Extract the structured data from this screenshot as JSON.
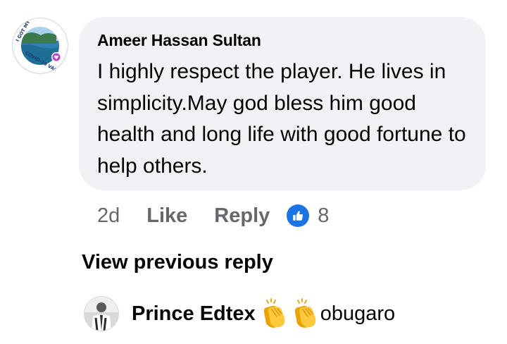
{
  "comment": {
    "author": "Ameer Hassan Sultan",
    "text": "I highly respect the player. He lives in simplicity.May god bless him good health and long life with good fortune to help others.",
    "avatar_frame_text": "I GOT MY COVID-19 VACCINE",
    "avatar_icon": "profile-photo-vaccine-frame",
    "time": "2d",
    "like_label": "Like",
    "reply_label": "Reply",
    "reaction_icon": "like-thumb-icon",
    "reaction_count": "8"
  },
  "view_previous_reply": "View previous reply",
  "reply_preview": {
    "author": "Prince Edtex",
    "emoji": "clapping-hands-icon",
    "text": "obugaro"
  },
  "colors": {
    "bubble": "#f0f2f5",
    "secondary_text": "#65676b",
    "like_blue": "#1b74e4",
    "primary_text": "#050505"
  }
}
